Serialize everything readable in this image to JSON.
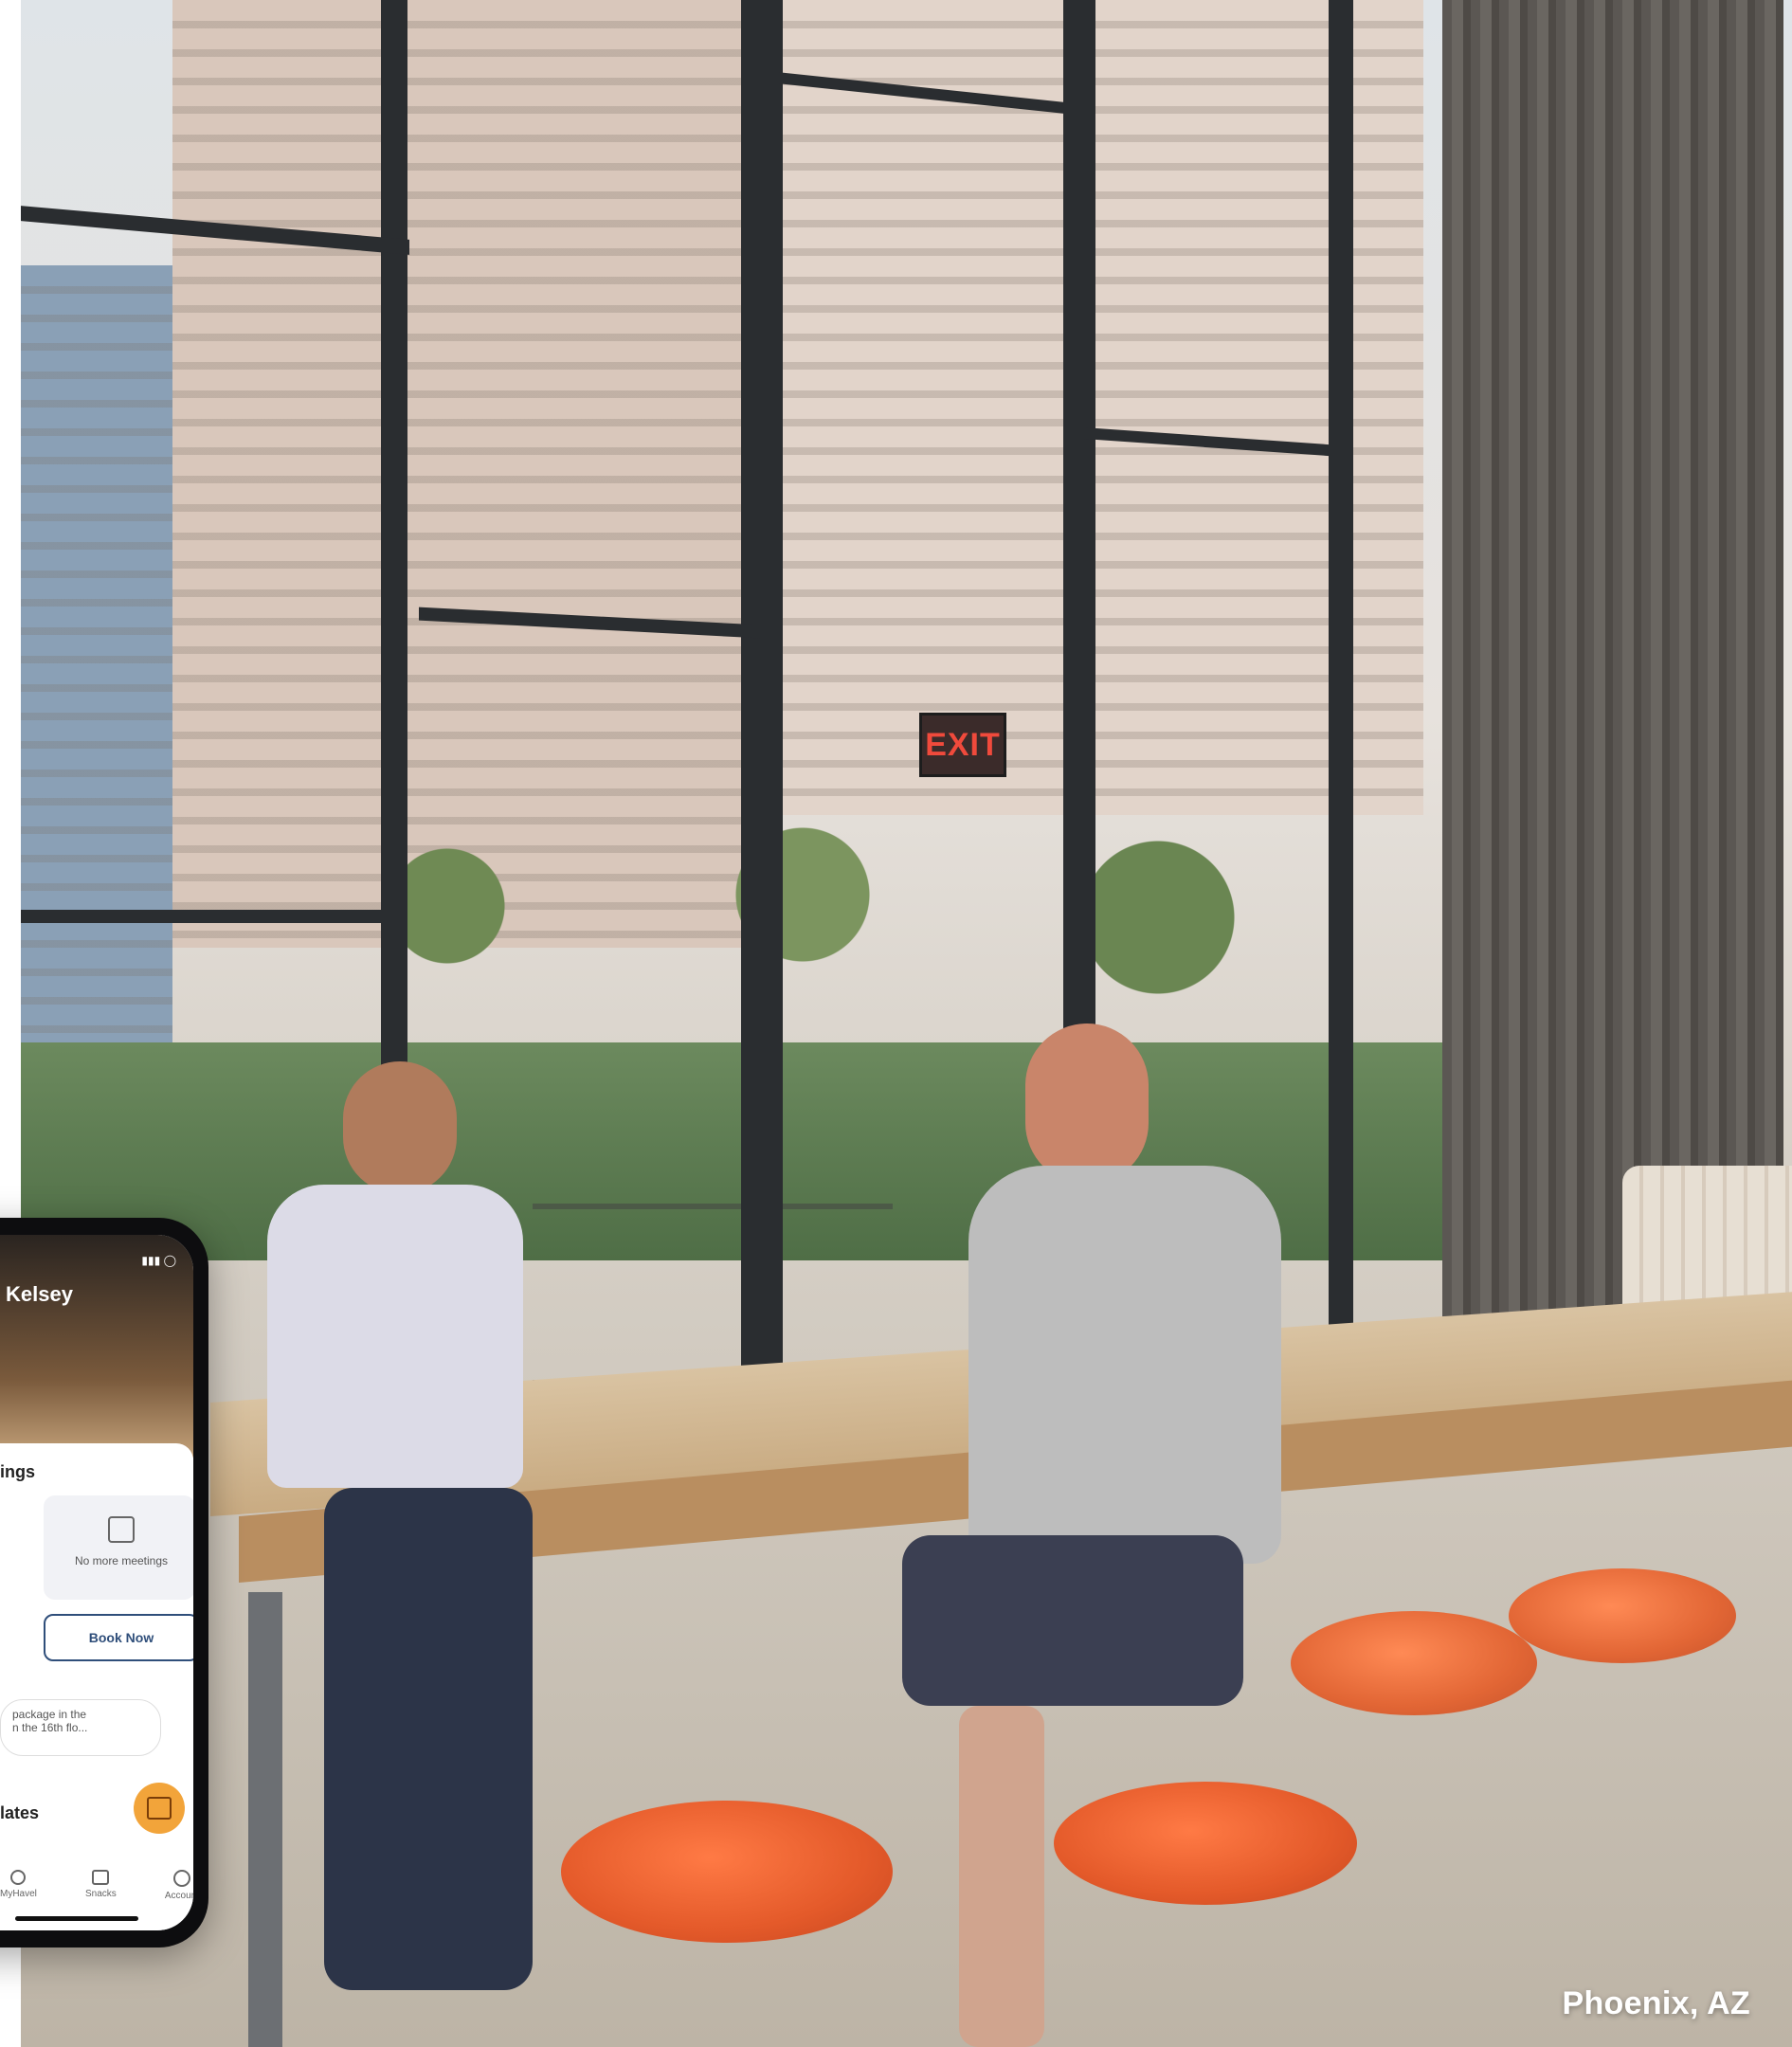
{
  "caption": "Phoenix, AZ",
  "exit_sign": "EXIT",
  "phone": {
    "greeting": "Kelsey",
    "section_meetings": "ings",
    "meetings_status": "No more meetings",
    "book_button": "Book Now",
    "package_notice": "package in the\nn the 16th flo...",
    "section_updates": "lates",
    "nav": [
      "MyHavel",
      "Snacks",
      "Account"
    ]
  }
}
